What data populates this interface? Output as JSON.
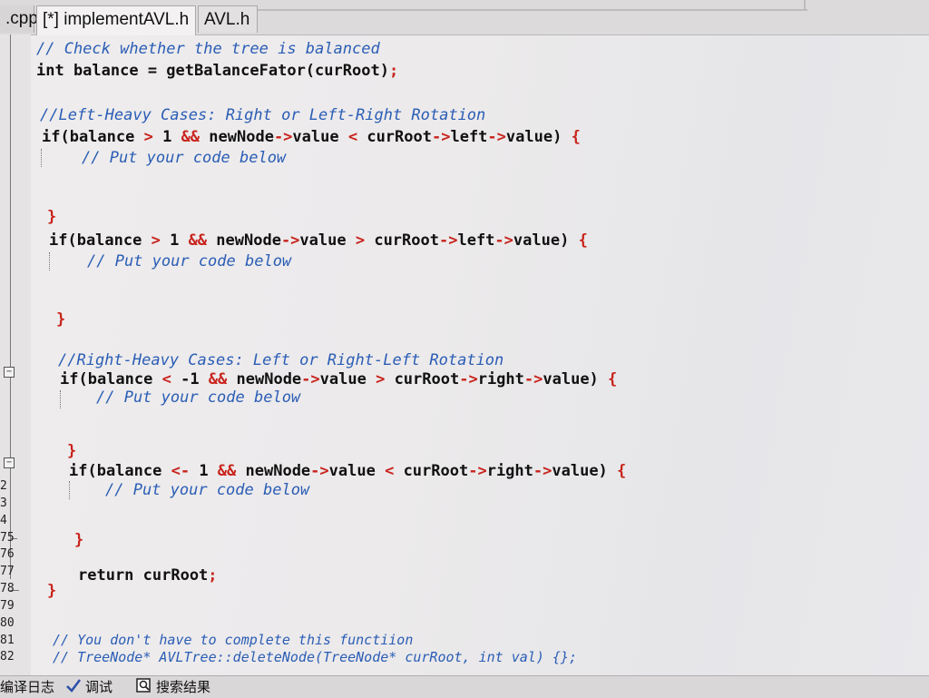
{
  "tabs": [
    {
      "label": ".cpp"
    },
    {
      "label": "[*] implementAVL.h"
    },
    {
      "label": "AVL.h"
    }
  ],
  "gutter": {
    "line_numbers": [
      "2",
      "3",
      "4",
      "75",
      "76",
      "77",
      "78",
      "79",
      "80",
      "81",
      "82"
    ]
  },
  "code": {
    "l01": "// Check whether the tree is balanced",
    "l02a": "int balance = getBalanceFator(curRoot)",
    "l02b": ";",
    "l03": "//Left-Heavy Cases: Right or Left-Right Rotation",
    "l04a": "if(balance ",
    "l04b": ">",
    "l04c": " 1 ",
    "l04d": "&&",
    "l04e": " newNode",
    "l04f": "->",
    "l04g": "value ",
    "l04h": "<",
    "l04i": " curRoot",
    "l04j": "->",
    "l04k": "left",
    "l04l": "->",
    "l04m": "value) ",
    "l04n": "{",
    "l05": "// Put your code below",
    "l06": "}",
    "l07a": "if(balance ",
    "l07b": ">",
    "l07c": " 1 ",
    "l07d": "&&",
    "l07e": " newNode",
    "l07f": "->",
    "l07g": "value ",
    "l07h": ">",
    "l07i": " curRoot",
    "l07j": "->",
    "l07k": "left",
    "l07l": "->",
    "l07m": "value) ",
    "l07n": "{",
    "l08": "// Put your code below",
    "l09": "}",
    "l10": "//Right-Heavy Cases: Left or Right-Left Rotation",
    "l11a": "if(balance ",
    "l11b": "<",
    "l11c": " -1 ",
    "l11d": "&&",
    "l11e": " newNode",
    "l11f": "->",
    "l11g": "value ",
    "l11h": ">",
    "l11i": " curRoot",
    "l11j": "->",
    "l11k": "right",
    "l11l": "->",
    "l11m": "value) ",
    "l11n": "{",
    "l12": "// Put your code below",
    "l13": "}",
    "l14a": "if(balance ",
    "l14b": "<-",
    "l14c": " 1 ",
    "l14d": "&&",
    "l14e": " newNode",
    "l14f": "->",
    "l14g": "value ",
    "l14h": "<",
    "l14i": " curRoot",
    "l14j": "->",
    "l14k": "right",
    "l14l": "->",
    "l14m": "value) ",
    "l14n": "{",
    "l15": "// Put your code below",
    "l16": "}",
    "l17a": "return curRoot",
    "l17b": ";",
    "l18": "}",
    "l19": "// You don't have to complete this functiion",
    "l20": "// TreeNode* AVLTree::deleteNode(TreeNode* curRoot, int val) {};"
  },
  "statusbar": {
    "compile_log": "编译日志",
    "debug": "调试",
    "search_results": "搜索结果"
  },
  "colors": {
    "comment": "#2a5db5",
    "operator": "#c8231c",
    "text": "#111111"
  }
}
